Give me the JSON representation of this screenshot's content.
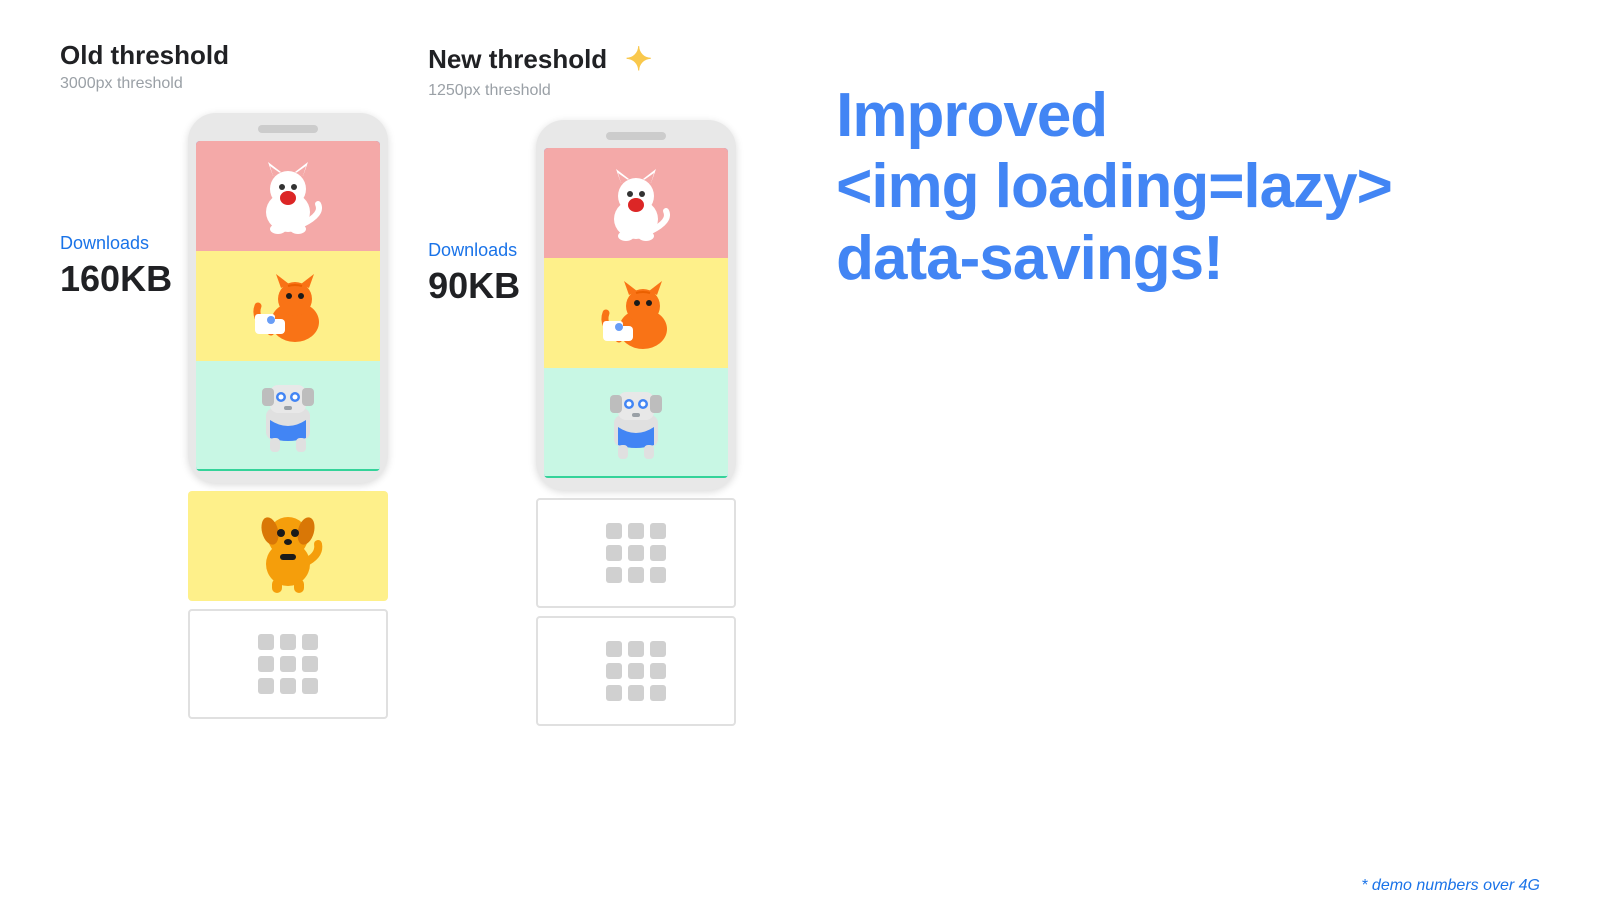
{
  "left_panel": {
    "title": "Old threshold",
    "subtitle": "3000px threshold",
    "downloads_label": "Downloads",
    "downloads_value": "160KB"
  },
  "right_panel": {
    "title": "New threshold",
    "subtitle": "1250px threshold",
    "downloads_label": "Downloads",
    "downloads_value": "90KB"
  },
  "headline_line1": "Improved",
  "headline_line2": "<img loading=lazy>",
  "headline_line3": "data-savings!",
  "demo_note": "* demo numbers over 4G",
  "sparkle": "✦"
}
